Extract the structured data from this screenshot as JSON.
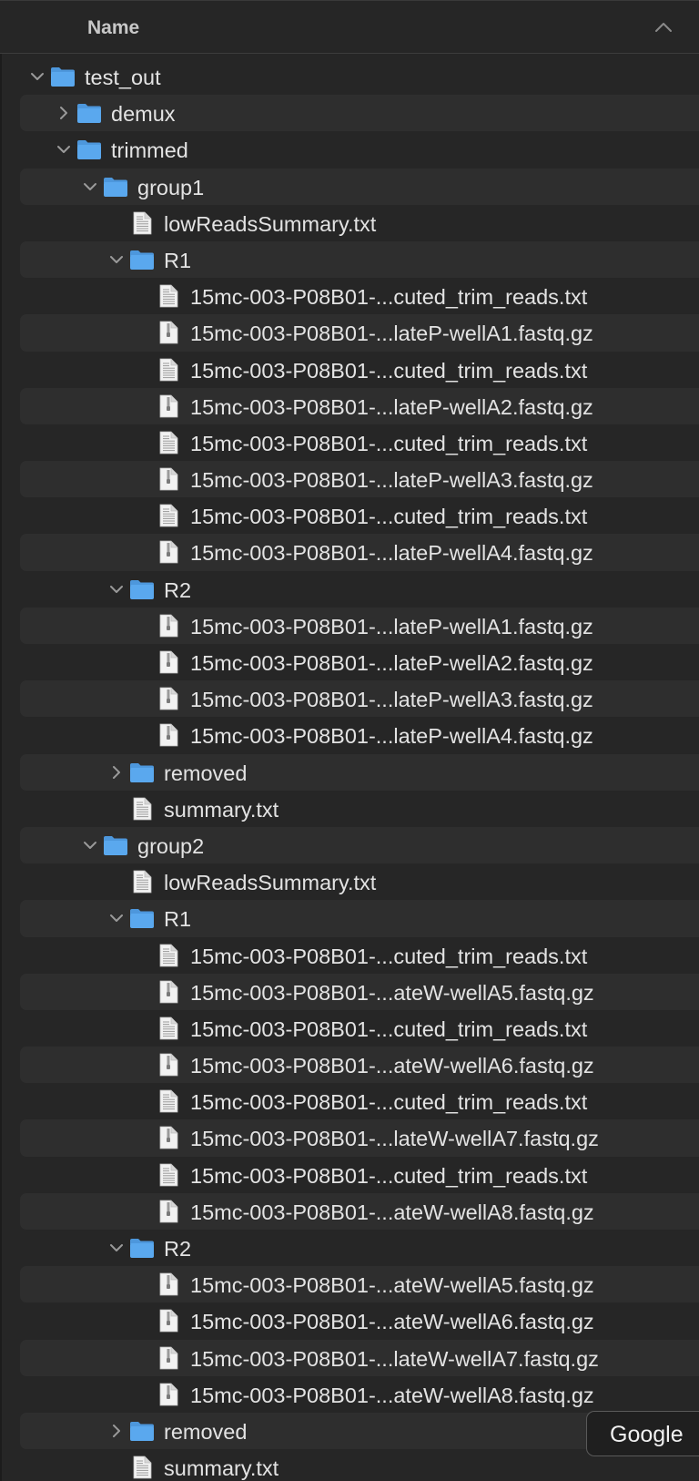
{
  "header": {
    "name_label": "Name",
    "sort_icon": "chevron-up-icon"
  },
  "colors": {
    "folder": "#5aa8ee",
    "folder_tab": "#4d97dc",
    "stripe": "#2e2e2e",
    "background": "#262626",
    "text": "#e3e3e3"
  },
  "rows": [
    {
      "label": "test_out",
      "kind": "folder",
      "depth": 0,
      "expanded": true
    },
    {
      "label": "demux",
      "kind": "folder",
      "depth": 1,
      "expanded": false
    },
    {
      "label": "trimmed",
      "kind": "folder",
      "depth": 1,
      "expanded": true
    },
    {
      "label": "group1",
      "kind": "folder",
      "depth": 2,
      "expanded": true
    },
    {
      "label": "lowReadsSummary.txt",
      "kind": "text",
      "depth": 3
    },
    {
      "label": "R1",
      "kind": "folder",
      "depth": 3,
      "expanded": true
    },
    {
      "label": "15mc-003-P08B01-...cuted_trim_reads.txt",
      "kind": "text",
      "depth": 4
    },
    {
      "label": "15mc-003-P08B01-...lateP-wellA1.fastq.gz",
      "kind": "archive",
      "depth": 4
    },
    {
      "label": "15mc-003-P08B01-...cuted_trim_reads.txt",
      "kind": "text",
      "depth": 4
    },
    {
      "label": "15mc-003-P08B01-...lateP-wellA2.fastq.gz",
      "kind": "archive",
      "depth": 4
    },
    {
      "label": "15mc-003-P08B01-...cuted_trim_reads.txt",
      "kind": "text",
      "depth": 4
    },
    {
      "label": "15mc-003-P08B01-...lateP-wellA3.fastq.gz",
      "kind": "archive",
      "depth": 4
    },
    {
      "label": "15mc-003-P08B01-...cuted_trim_reads.txt",
      "kind": "text",
      "depth": 4
    },
    {
      "label": "15mc-003-P08B01-...lateP-wellA4.fastq.gz",
      "kind": "archive",
      "depth": 4
    },
    {
      "label": "R2",
      "kind": "folder",
      "depth": 3,
      "expanded": true
    },
    {
      "label": "15mc-003-P08B01-...lateP-wellA1.fastq.gz",
      "kind": "archive",
      "depth": 4
    },
    {
      "label": "15mc-003-P08B01-...lateP-wellA2.fastq.gz",
      "kind": "archive",
      "depth": 4
    },
    {
      "label": "15mc-003-P08B01-...lateP-wellA3.fastq.gz",
      "kind": "archive",
      "depth": 4
    },
    {
      "label": "15mc-003-P08B01-...lateP-wellA4.fastq.gz",
      "kind": "archive",
      "depth": 4
    },
    {
      "label": "removed",
      "kind": "folder",
      "depth": 3,
      "expanded": false
    },
    {
      "label": "summary.txt",
      "kind": "text",
      "depth": 3
    },
    {
      "label": "group2",
      "kind": "folder",
      "depth": 2,
      "expanded": true
    },
    {
      "label": "lowReadsSummary.txt",
      "kind": "text",
      "depth": 3
    },
    {
      "label": "R1",
      "kind": "folder",
      "depth": 3,
      "expanded": true
    },
    {
      "label": "15mc-003-P08B01-...cuted_trim_reads.txt",
      "kind": "text",
      "depth": 4
    },
    {
      "label": "15mc-003-P08B01-...ateW-wellA5.fastq.gz",
      "kind": "archive",
      "depth": 4
    },
    {
      "label": "15mc-003-P08B01-...cuted_trim_reads.txt",
      "kind": "text",
      "depth": 4
    },
    {
      "label": "15mc-003-P08B01-...ateW-wellA6.fastq.gz",
      "kind": "archive",
      "depth": 4
    },
    {
      "label": "15mc-003-P08B01-...cuted_trim_reads.txt",
      "kind": "text",
      "depth": 4
    },
    {
      "label": "15mc-003-P08B01-...lateW-wellA7.fastq.gz",
      "kind": "archive",
      "depth": 4
    },
    {
      "label": "15mc-003-P08B01-...cuted_trim_reads.txt",
      "kind": "text",
      "depth": 4
    },
    {
      "label": "15mc-003-P08B01-...ateW-wellA8.fastq.gz",
      "kind": "archive",
      "depth": 4
    },
    {
      "label": "R2",
      "kind": "folder",
      "depth": 3,
      "expanded": true
    },
    {
      "label": "15mc-003-P08B01-...ateW-wellA5.fastq.gz",
      "kind": "archive",
      "depth": 4
    },
    {
      "label": "15mc-003-P08B01-...ateW-wellA6.fastq.gz",
      "kind": "archive",
      "depth": 4
    },
    {
      "label": "15mc-003-P08B01-...lateW-wellA7.fastq.gz",
      "kind": "archive",
      "depth": 4
    },
    {
      "label": "15mc-003-P08B01-...ateW-wellA8.fastq.gz",
      "kind": "archive",
      "depth": 4
    },
    {
      "label": "removed",
      "kind": "folder",
      "depth": 3,
      "expanded": false
    },
    {
      "label": "summary.txt",
      "kind": "text",
      "depth": 3
    }
  ],
  "tooltip": {
    "text": "Google"
  }
}
